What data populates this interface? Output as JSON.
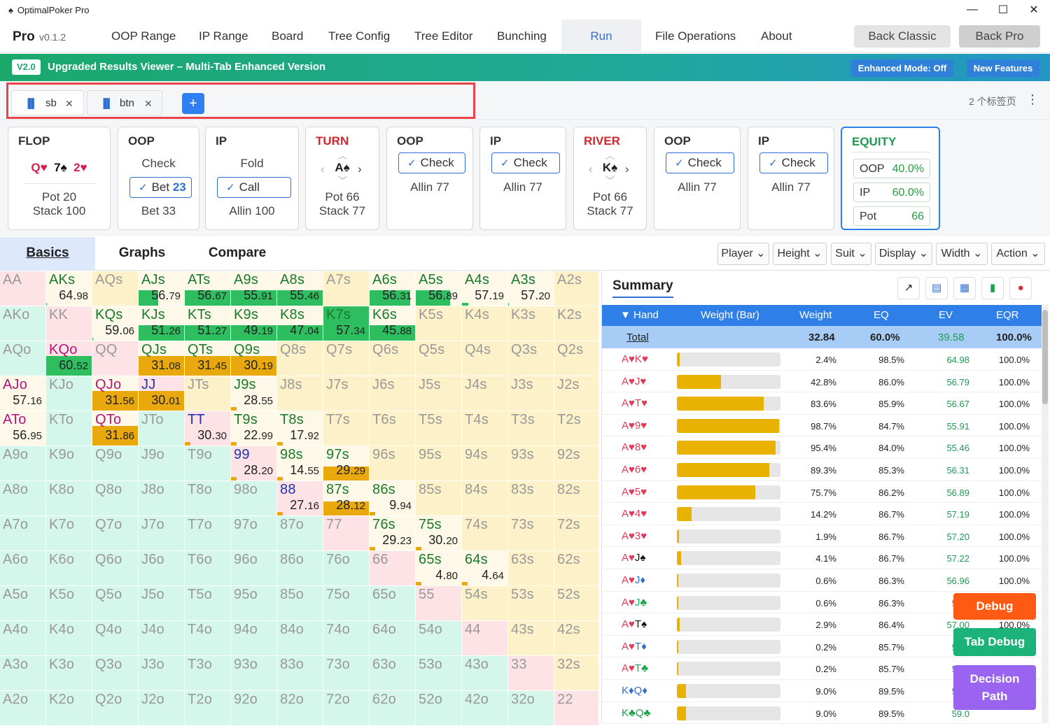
{
  "window": {
    "title": "OptimalPoker Pro",
    "icon": "spade-icon"
  },
  "menubar": {
    "brand": "Pro",
    "version": "v0.1.2",
    "items": [
      "OOP Range",
      "IP Range",
      "Board",
      "Tree Config",
      "Tree Editor",
      "Bunching",
      "Run Solver",
      "File Operations",
      "About"
    ],
    "active": "Run Solver",
    "back_classic": "Back Classic",
    "back_pro": "Back Pro"
  },
  "banner": {
    "badge": "V2.0",
    "title": "Upgraded Results Viewer – Multi-Tab Enhanced Version",
    "enhanced": "Enhanced Mode: Off",
    "new_features": "New Features"
  },
  "tabs": {
    "items": [
      {
        "label": "sb"
      },
      {
        "label": "btn"
      }
    ],
    "count_text": "2 个标签页"
  },
  "street": {
    "flop": {
      "title": "FLOP",
      "cards": [
        {
          "r": "Q",
          "s": "♥",
          "c": "#d6214e"
        },
        {
          "r": "7",
          "s": "♠",
          "c": "#111"
        },
        {
          "r": "2",
          "s": "♥",
          "c": "#d6214e"
        }
      ],
      "pot": "Pot 20",
      "stack": "Stack 100"
    },
    "oop1": {
      "title": "OOP",
      "a1": "Check",
      "sel_label": "Bet",
      "sel_val": "23",
      "a3": "Bet 33"
    },
    "ip1": {
      "title": "IP",
      "a1": "Fold",
      "sel": "Call",
      "a3": "Allin 100"
    },
    "turn": {
      "title": "TURN",
      "card_r": "A",
      "card_s": "♠",
      "pot": "Pot 66",
      "stack": "Stack 77"
    },
    "oop2": {
      "title": "OOP",
      "sel": "Check",
      "a2": "Allin 77"
    },
    "ip2": {
      "title": "IP",
      "sel": "Check",
      "a2": "Allin 77"
    },
    "river": {
      "title": "RIVER",
      "card_r": "K",
      "card_s": "♠",
      "pot": "Pot 66",
      "stack": "Stack 77"
    },
    "oop3": {
      "title": "OOP",
      "sel": "Check",
      "a2": "Allin 77"
    },
    "ip3": {
      "title": "IP",
      "sel": "Check",
      "a2": "Allin 77"
    },
    "equity": {
      "title": "EQUITY",
      "rows": [
        {
          "k": "OOP",
          "v": "40.0%"
        },
        {
          "k": "IP",
          "v": "60.0%"
        },
        {
          "k": "Pot",
          "v": "66"
        }
      ]
    }
  },
  "view_tabs": [
    "Basics",
    "Graphs",
    "Compare"
  ],
  "dropdowns": [
    "Player",
    "Height",
    "Suit",
    "Display",
    "Width",
    "Action"
  ],
  "matrix": {
    "colors": {
      "pair": "#fde2e6",
      "suited": "#fdf1c9",
      "offsuit": "#d5f6ea",
      "green": "#2ebd5f",
      "gold": "#e9a80b",
      "pale": "#fdf8e8"
    },
    "values": {
      "AKs": "64.98",
      "AJs": "56.79",
      "ATs": "56.67",
      "A9s": "55.91",
      "A8s": "55.46",
      "A6s": "56.31",
      "A5s": "56.89",
      "A4s": "57.19",
      "A3s": "57.20",
      "KQs": "59.06",
      "KJs": "51.26",
      "KTs": "51.27",
      "K9s": "49.19",
      "K8s": "47.04",
      "K7s": "57.34",
      "K6s": "45.88",
      "KQo": "60.52",
      "QJs": "31.08",
      "QTs": "31.45",
      "Q9s": "30.19",
      "AJo": "57.16",
      "QJo": "31.56",
      "JJ": "30.01",
      "J9s": "28.55",
      "ATo": "56.95",
      "QTo": "31.86",
      "TT": "30.30",
      "T9s": "22.99",
      "T8s": "17.92",
      "99": "28.20",
      "98s": "14.55",
      "97s": "29.29",
      "88": "27.16",
      "87s": "28.12",
      "86s": "9.94",
      "76s": "29.23",
      "75s": "30.20",
      "65s": "4.80",
      "64s": "4.64"
    }
  },
  "summary": {
    "title": "Summary",
    "icons": [
      "external-link-icon",
      "map-icon",
      "document-icon",
      "bar-chart-icon",
      "location-pin-icon"
    ],
    "columns": [
      "▼ Hand",
      "Weight (Bar)",
      "Weight",
      "EQ",
      "EV",
      "EQR"
    ],
    "total": {
      "hand": "Total",
      "weight": "32.84",
      "eq": "60.0%",
      "ev": "39.58",
      "eqr": "100.0%"
    },
    "rows": [
      {
        "hand": "A♥K♥",
        "hc": [
          "#e03a5a",
          "#e03a5a"
        ],
        "bar": 0.024,
        "weight": "2.4%",
        "eq": "98.5%",
        "ev": "64.98",
        "eqr": "100.0%"
      },
      {
        "hand": "A♥J♥",
        "hc": [
          "#e03a5a",
          "#e03a5a"
        ],
        "bar": 0.428,
        "weight": "42.8%",
        "eq": "86.0%",
        "ev": "56.79",
        "eqr": "100.0%"
      },
      {
        "hand": "A♥T♥",
        "hc": [
          "#e03a5a",
          "#e03a5a"
        ],
        "bar": 0.836,
        "weight": "83.6%",
        "eq": "85.9%",
        "ev": "56.67",
        "eqr": "100.0%"
      },
      {
        "hand": "A♥9♥",
        "hc": [
          "#e03a5a",
          "#e03a5a"
        ],
        "bar": 0.987,
        "weight": "98.7%",
        "eq": "84.7%",
        "ev": "55.91",
        "eqr": "100.0%"
      },
      {
        "hand": "A♥8♥",
        "hc": [
          "#e03a5a",
          "#e03a5a"
        ],
        "bar": 0.954,
        "weight": "95.4%",
        "eq": "84.0%",
        "ev": "55.46",
        "eqr": "100.0%"
      },
      {
        "hand": "A♥6♥",
        "hc": [
          "#e03a5a",
          "#e03a5a"
        ],
        "bar": 0.893,
        "weight": "89.3%",
        "eq": "85.3%",
        "ev": "56.31",
        "eqr": "100.0%"
      },
      {
        "hand": "A♥5♥",
        "hc": [
          "#e03a5a",
          "#e03a5a"
        ],
        "bar": 0.757,
        "weight": "75.7%",
        "eq": "86.2%",
        "ev": "56.89",
        "eqr": "100.0%"
      },
      {
        "hand": "A♥4♥",
        "hc": [
          "#e03a5a",
          "#e03a5a"
        ],
        "bar": 0.142,
        "weight": "14.2%",
        "eq": "86.7%",
        "ev": "57.19",
        "eqr": "100.0%"
      },
      {
        "hand": "A♥3♥",
        "hc": [
          "#e03a5a",
          "#e03a5a"
        ],
        "bar": 0.019,
        "weight": "1.9%",
        "eq": "86.7%",
        "ev": "57.20",
        "eqr": "100.0%"
      },
      {
        "hand": "A♥J♠",
        "hc": [
          "#e03a5a",
          "#111"
        ],
        "bar": 0.041,
        "weight": "4.1%",
        "eq": "86.7%",
        "ev": "57.22",
        "eqr": "100.0%"
      },
      {
        "hand": "A♥J♦",
        "hc": [
          "#e03a5a",
          "#2f6fd0"
        ],
        "bar": 0.006,
        "weight": "0.6%",
        "eq": "86.3%",
        "ev": "56.96",
        "eqr": "100.0%"
      },
      {
        "hand": "A♥J♣",
        "hc": [
          "#e03a5a",
          "#1aa34a"
        ],
        "bar": 0.006,
        "weight": "0.6%",
        "eq": "86.3%",
        "ev": "56.9",
        "eqr": ""
      },
      {
        "hand": "A♥T♠",
        "hc": [
          "#e03a5a",
          "#111"
        ],
        "bar": 0.029,
        "weight": "2.9%",
        "eq": "86.4%",
        "ev": "57.00",
        "eqr": "100.0%"
      },
      {
        "hand": "A♥T♦",
        "hc": [
          "#e03a5a",
          "#2f6fd0"
        ],
        "bar": 0.002,
        "weight": "0.2%",
        "eq": "85.7%",
        "ev": "56.5",
        "eqr": ""
      },
      {
        "hand": "A♥T♣",
        "hc": [
          "#e03a5a",
          "#1aa34a"
        ],
        "bar": 0.002,
        "weight": "0.2%",
        "eq": "85.7%",
        "ev": "56.5",
        "eqr": ""
      },
      {
        "hand": "K♦Q♦",
        "hc": [
          "#2f6fd0",
          "#2f6fd0"
        ],
        "bar": 0.09,
        "weight": "9.0%",
        "eq": "89.5%",
        "ev": "59.0",
        "eqr": ""
      },
      {
        "hand": "K♣Q♣",
        "hc": [
          "#1aa34a",
          "#1aa34a"
        ],
        "bar": 0.09,
        "weight": "9.0%",
        "eq": "89.5%",
        "ev": "59.0",
        "eqr": ""
      }
    ]
  },
  "floating": {
    "debug": "Debug",
    "tab_debug": "Tab Debug",
    "decision_path": "Decision Path"
  }
}
